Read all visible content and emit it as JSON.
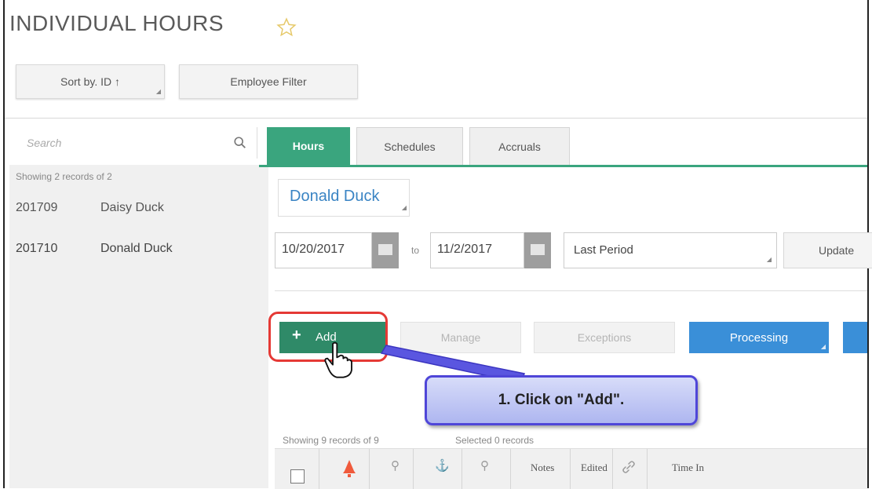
{
  "page": {
    "title": "INDIVIDUAL HOURS"
  },
  "toolbar": {
    "sort_label": "Sort by. ID ↑",
    "filter_label": "Employee Filter"
  },
  "search": {
    "placeholder": "Search"
  },
  "tabs": [
    {
      "label": "Hours",
      "active": true
    },
    {
      "label": "Schedules",
      "active": false
    },
    {
      "label": "Accruals",
      "active": false
    }
  ],
  "sidebar": {
    "count_text": "Showing 2 records of 2",
    "employees": [
      {
        "id": "201709",
        "name": "Daisy Duck",
        "selected": false
      },
      {
        "id": "201710",
        "name": "Donald Duck",
        "selected": true
      }
    ]
  },
  "employee_selector": {
    "value": "Donald Duck"
  },
  "date_range": {
    "from": "10/20/2017",
    "to_label": "to",
    "to": "11/2/2017",
    "period": "Last Period",
    "update_label": "Update"
  },
  "actions": {
    "add": "Add",
    "manage": "Manage",
    "exceptions": "Exceptions",
    "processing": "Processing"
  },
  "callout": {
    "text": "1. Click on \"Add\"."
  },
  "table": {
    "records_text": "Showing 9 records of 9",
    "selected_text": "Selected 0 records",
    "columns": [
      "Notes",
      "Edited",
      "Time In"
    ]
  },
  "colors": {
    "accent_green": "#3aa57e",
    "action_blue": "#3a8fd8",
    "link_blue": "#3a84c4"
  }
}
